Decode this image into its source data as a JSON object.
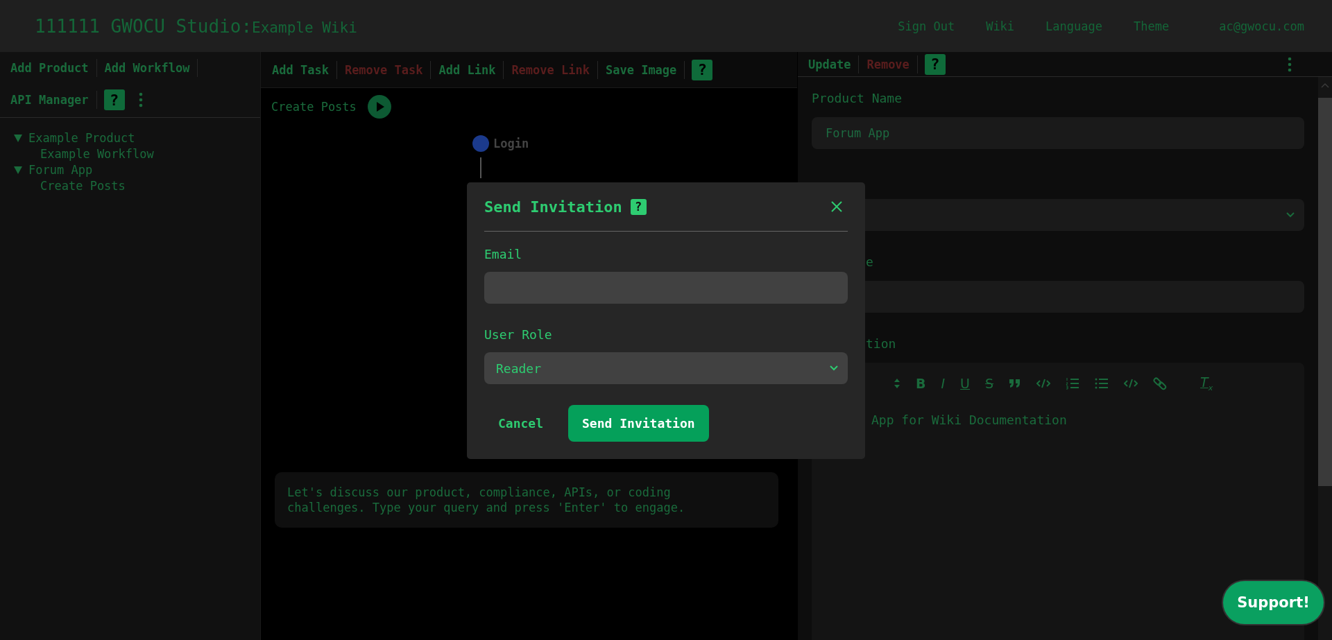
{
  "header": {
    "title": "111111 GWOCU Studio:",
    "subtitle": "Example Wiki",
    "nav": [
      {
        "label": "Sign Out"
      },
      {
        "label": "Wiki"
      },
      {
        "label": "Language"
      },
      {
        "label": "Theme"
      },
      {
        "label": "ac@gwocu.com"
      }
    ]
  },
  "left_panel": {
    "toolbar_rows": [
      [
        {
          "kind": "button",
          "label": "Add Product"
        },
        {
          "kind": "button",
          "label": "Add Workflow"
        }
      ],
      [
        {
          "kind": "button",
          "label": "API Manager"
        },
        {
          "kind": "help",
          "label": "?"
        },
        {
          "kind": "more"
        }
      ]
    ],
    "tree": [
      {
        "label": "Example Product",
        "expanded": true,
        "children": [
          {
            "label": "Example Workflow"
          }
        ]
      },
      {
        "label": "Forum App",
        "expanded": true,
        "children": [
          {
            "label": "Create Posts"
          }
        ]
      }
    ]
  },
  "canvas": {
    "toolbar": [
      {
        "kind": "button",
        "label": "Add Task",
        "danger": false
      },
      {
        "kind": "button",
        "label": "Remove Task",
        "danger": true
      },
      {
        "kind": "button",
        "label": "Add Link",
        "danger": false
      },
      {
        "kind": "button",
        "label": "Remove Link",
        "danger": true
      },
      {
        "kind": "button",
        "label": "Save Image",
        "danger": false
      },
      {
        "kind": "help",
        "label": "?"
      }
    ],
    "workflow_title": "Create Posts",
    "nodes": [
      {
        "label": "Login"
      }
    ],
    "chat": {
      "placeholder": "Let's discuss our product, compliance, APIs, or coding challenges. Type your query and press 'Enter' to engage."
    }
  },
  "right_panel": {
    "toolbar": [
      {
        "kind": "button",
        "label": "Update",
        "danger": false
      },
      {
        "kind": "button",
        "label": "Remove",
        "danger": true
      },
      {
        "kind": "help",
        "label": "?"
      },
      {
        "kind": "more"
      }
    ],
    "fields": [
      {
        "kind": "input",
        "label": "Product Name",
        "placeholder": "Forum App",
        "covered": false
      },
      {
        "kind": "select"
      },
      {
        "kind": "input",
        "label": "e",
        "covered": true
      },
      {
        "kind": "editor",
        "label": "tion",
        "text": "App for Wiki Documentation",
        "covered": true
      }
    ],
    "editor_toolbar": [
      {
        "kind": "heading"
      },
      {
        "kind": "bold",
        "glyph": "B"
      },
      {
        "kind": "italic",
        "glyph": "I"
      },
      {
        "kind": "underline",
        "glyph": "U"
      },
      {
        "kind": "strike",
        "glyph": "S"
      },
      {
        "kind": "quote"
      },
      {
        "kind": "code"
      },
      {
        "kind": "ordered-list"
      },
      {
        "kind": "bullet-list"
      },
      {
        "kind": "code"
      },
      {
        "kind": "link"
      },
      {
        "kind": "clear",
        "glyph": "T",
        "sub": "x"
      }
    ]
  },
  "dialog": {
    "title": "Send Invitation",
    "help": "?",
    "fields": [
      {
        "kind": "input",
        "label": "Email"
      },
      {
        "kind": "select",
        "label": "User Role",
        "value": "Reader"
      }
    ],
    "buttons": [
      {
        "label": "Cancel",
        "primary": false
      },
      {
        "label": "Send Invitation",
        "primary": true
      }
    ]
  },
  "support_button": "Support!"
}
